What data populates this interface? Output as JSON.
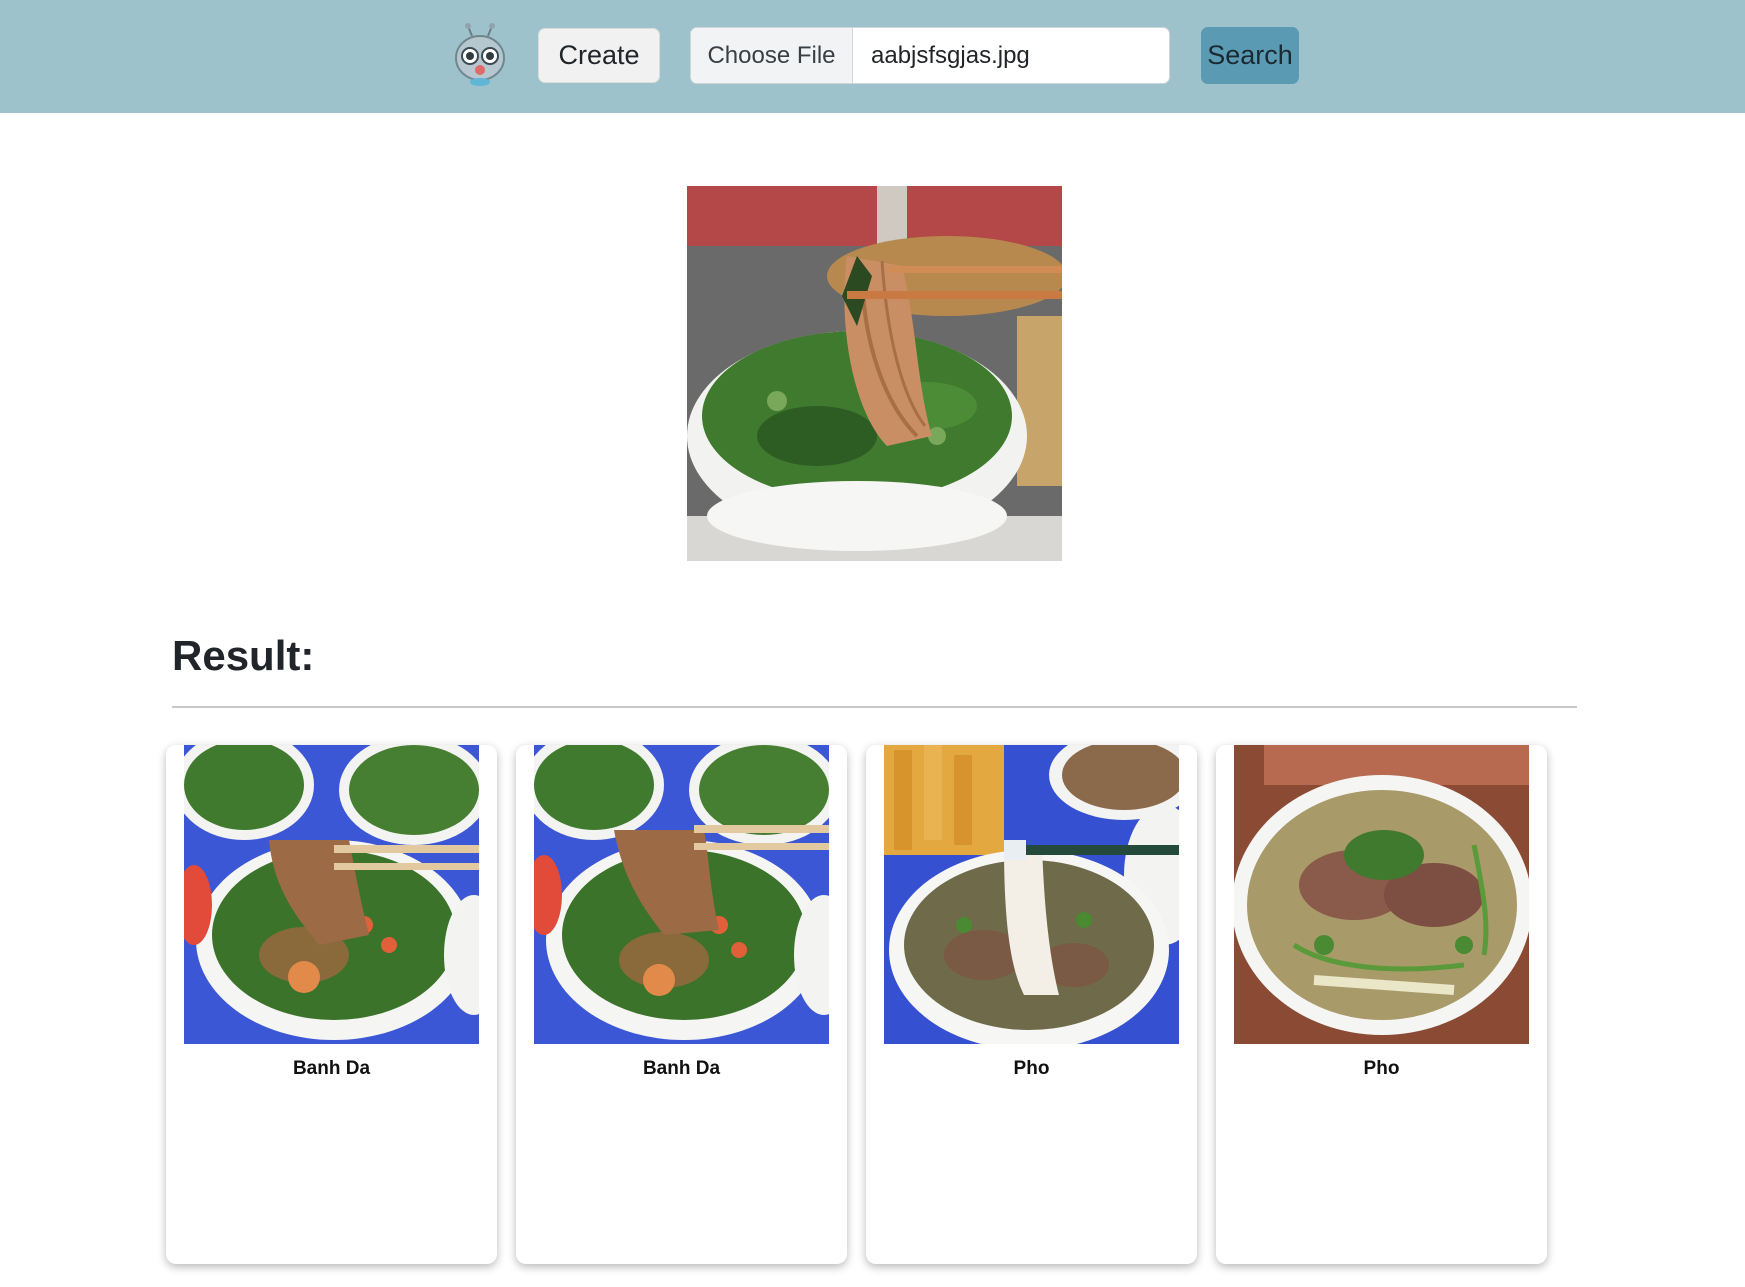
{
  "navbar": {
    "logo_icon": "robot-logo-icon",
    "create_label": "Create",
    "file_input": {
      "button_label": "Choose File",
      "file_name": "aabjsfsgjas.jpg"
    },
    "search_label": "Search",
    "colors": {
      "background": "#9ec2cc",
      "search_button": "#5a9ab2"
    }
  },
  "query_image": {
    "subject": "noodle-soup-with-chopsticks-image"
  },
  "results": {
    "title": "Result:",
    "items": [
      {
        "label": "Banh Da"
      },
      {
        "label": "Banh Da"
      },
      {
        "label": "Pho"
      },
      {
        "label": "Pho"
      }
    ]
  }
}
